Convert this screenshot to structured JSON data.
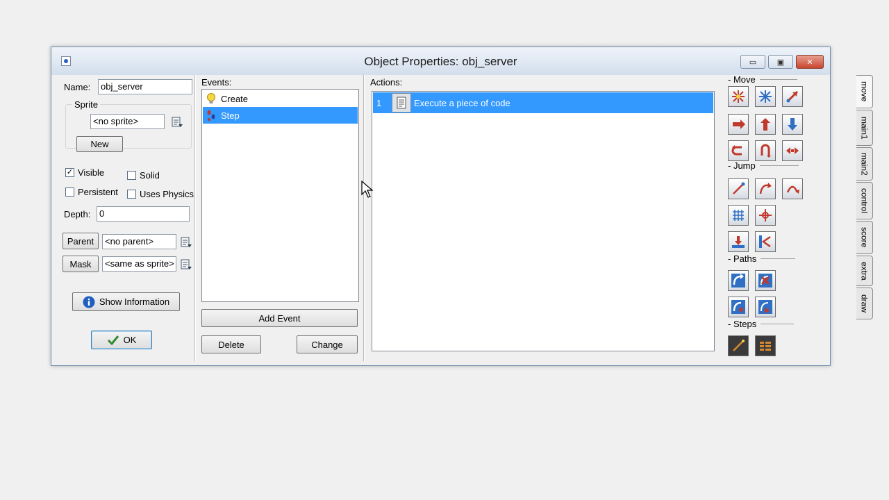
{
  "window": {
    "title": "Object Properties: obj_server",
    "minimize": "▭",
    "maximize": "▣",
    "close": "✕"
  },
  "left": {
    "name_label": "Name:",
    "name_value": "obj_server",
    "sprite_group": "Sprite",
    "sprite_value": "<no sprite>",
    "new_button": "New",
    "visible_label": "Visible",
    "visible_checked": "✓",
    "solid_label": "Solid",
    "persistent_label": "Persistent",
    "uses_physics_label": "Uses Physics",
    "depth_label": "Depth:",
    "depth_value": "0",
    "parent_button": "Parent",
    "parent_value": "<no parent>",
    "mask_button": "Mask",
    "mask_value": "<same as sprite>",
    "show_info_button": "Show Information",
    "ok_button": "OK"
  },
  "events": {
    "label": "Events:",
    "items": [
      {
        "label": "Create",
        "icon": "lightbulb-icon"
      },
      {
        "label": "Step",
        "icon": "footsteps-icon"
      }
    ],
    "add_event_button": "Add Event",
    "delete_button": "Delete",
    "change_button": "Change"
  },
  "actions": {
    "label": "Actions:",
    "items": [
      {
        "index": "1",
        "label": "Execute a piece of code",
        "icon": "code-page-icon"
      }
    ]
  },
  "palette": {
    "sections": [
      "Move",
      "Jump",
      "Paths",
      "Steps"
    ],
    "tabs": [
      "move",
      "main1",
      "main2",
      "control",
      "score",
      "extra",
      "draw"
    ],
    "active_tab": "move"
  },
  "colors": {
    "selection": "#3399ff",
    "action_red": "#c0392b",
    "action_blue": "#2f6fc4"
  }
}
